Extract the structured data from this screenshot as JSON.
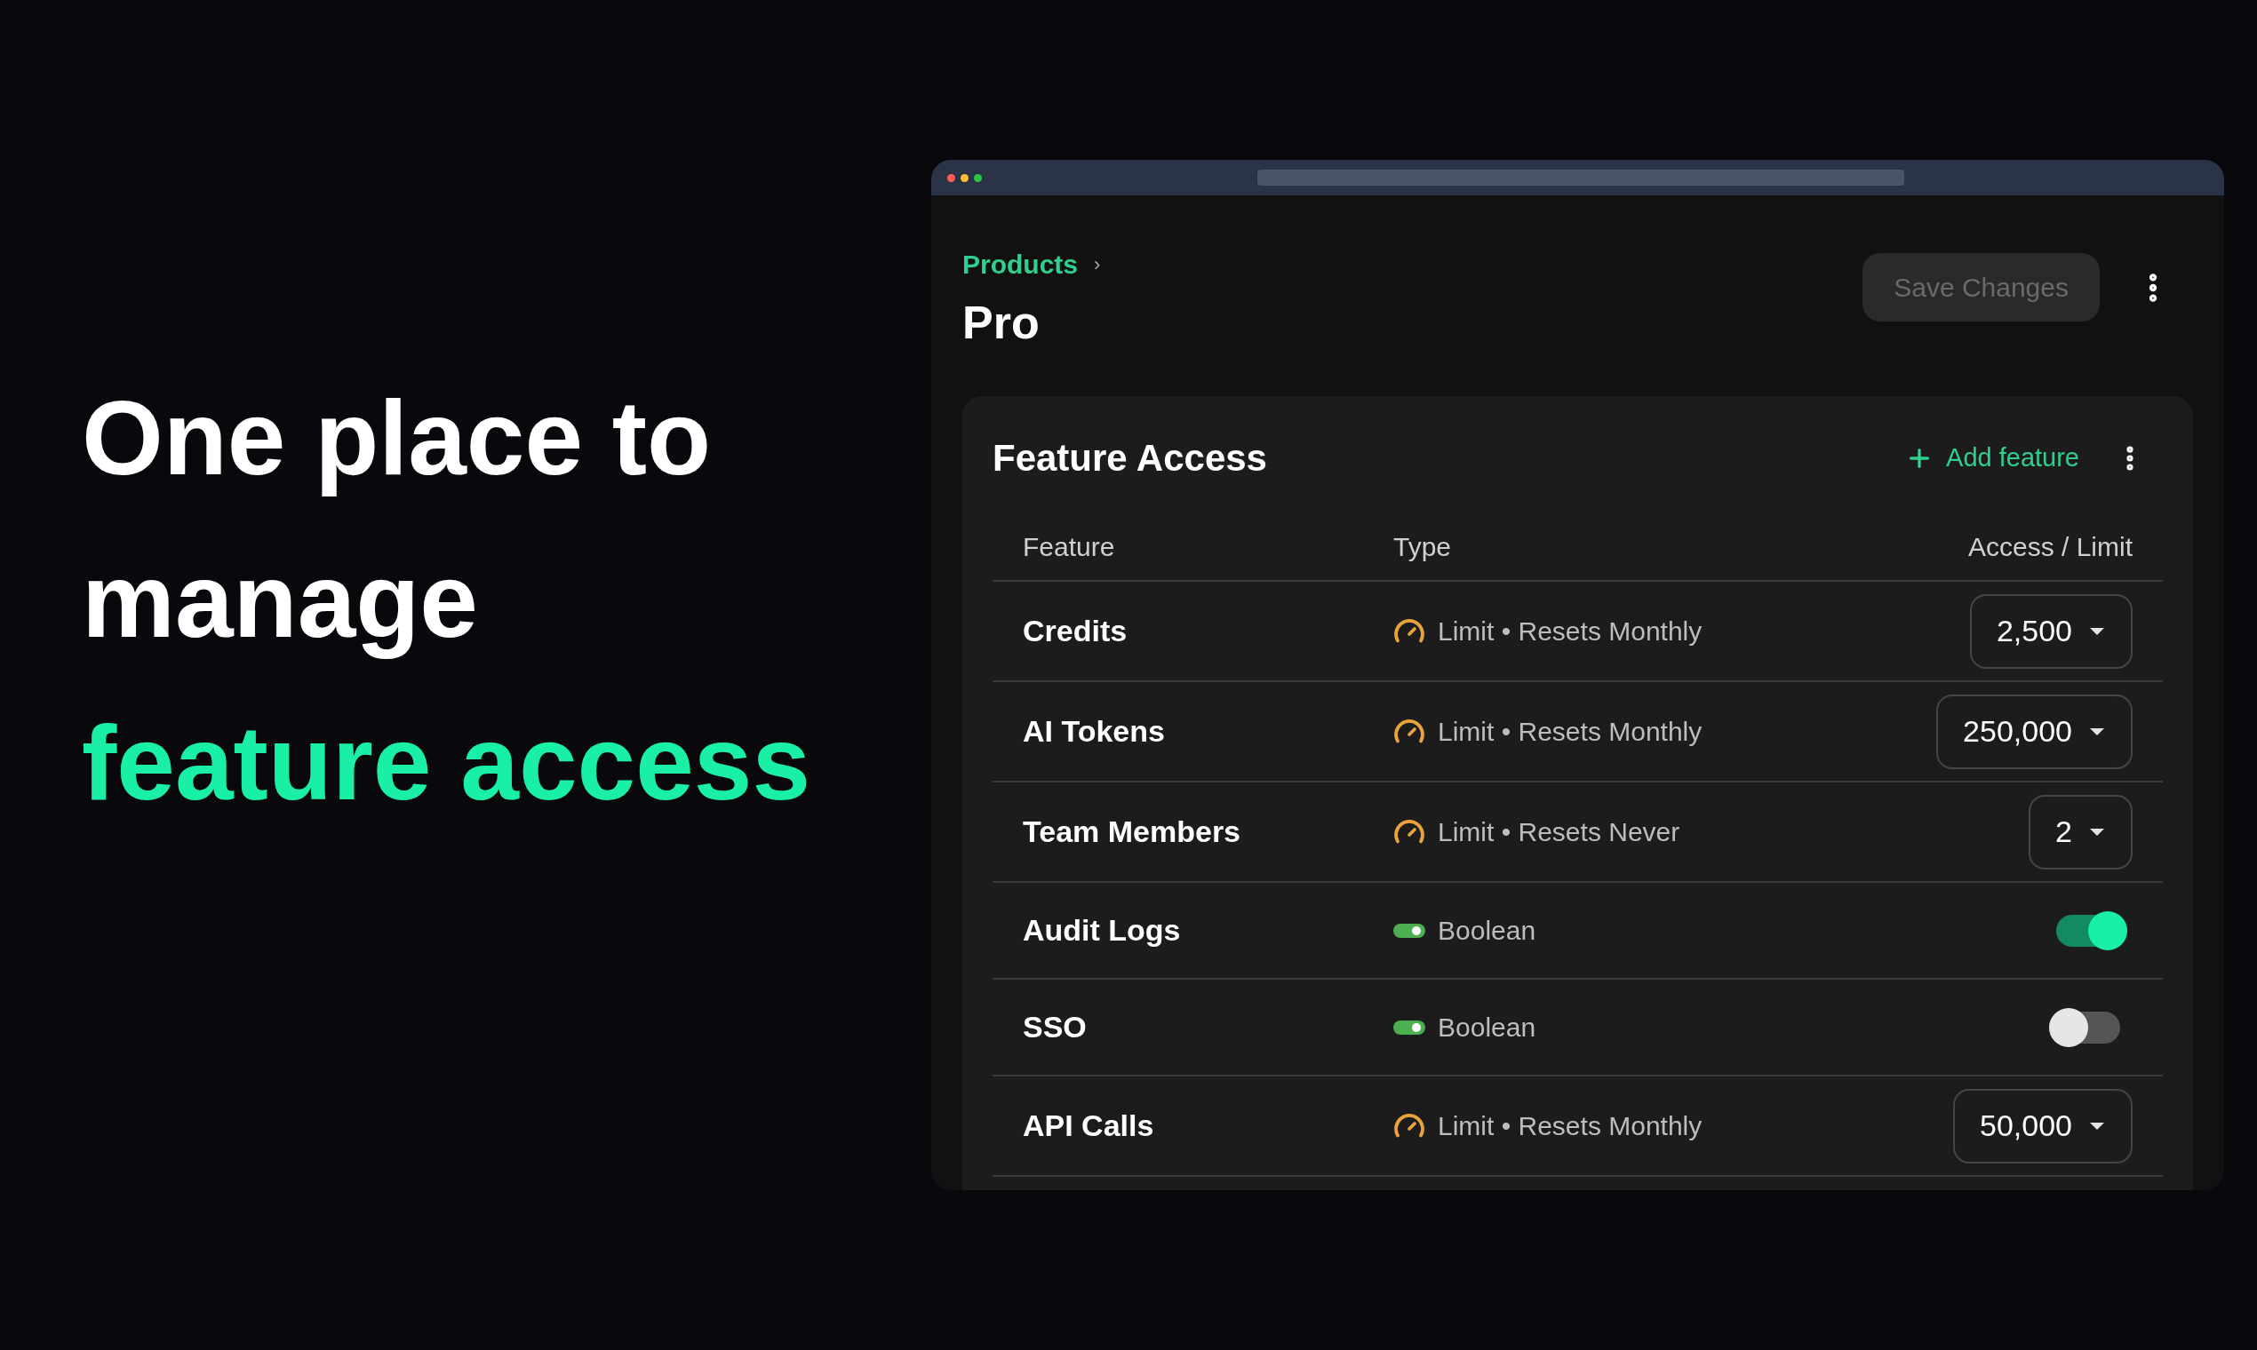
{
  "headline": {
    "lines": [
      "One place to",
      "manage"
    ],
    "accent": "feature access"
  },
  "window": {
    "breadcrumb": "Products",
    "breadcrumb_separator": "›",
    "title": "Pro",
    "save_button": {
      "label": "Save Changes",
      "disabled": true
    }
  },
  "card": {
    "title": "Feature Access",
    "add_button": "Add feature",
    "columns": [
      "Feature",
      "Type",
      "Access / Limit"
    ],
    "rows": [
      {
        "kind": "limit",
        "name": "Credits",
        "type": "Limit • Resets Monthly",
        "value": "2,500"
      },
      {
        "kind": "limit",
        "name": "AI Tokens",
        "type": "Limit • Resets Monthly",
        "value": "250,000"
      },
      {
        "kind": "limit",
        "name": "Team Members",
        "type": "Limit • Resets Never",
        "value": "2"
      },
      {
        "kind": "boolean",
        "name": "Audit Logs",
        "type": "Boolean",
        "on": true
      },
      {
        "kind": "boolean",
        "name": "SSO",
        "type": "Boolean",
        "on": false
      },
      {
        "kind": "limit",
        "name": "API Calls",
        "type": "Limit • Resets Monthly",
        "value": "50,000"
      }
    ]
  }
}
